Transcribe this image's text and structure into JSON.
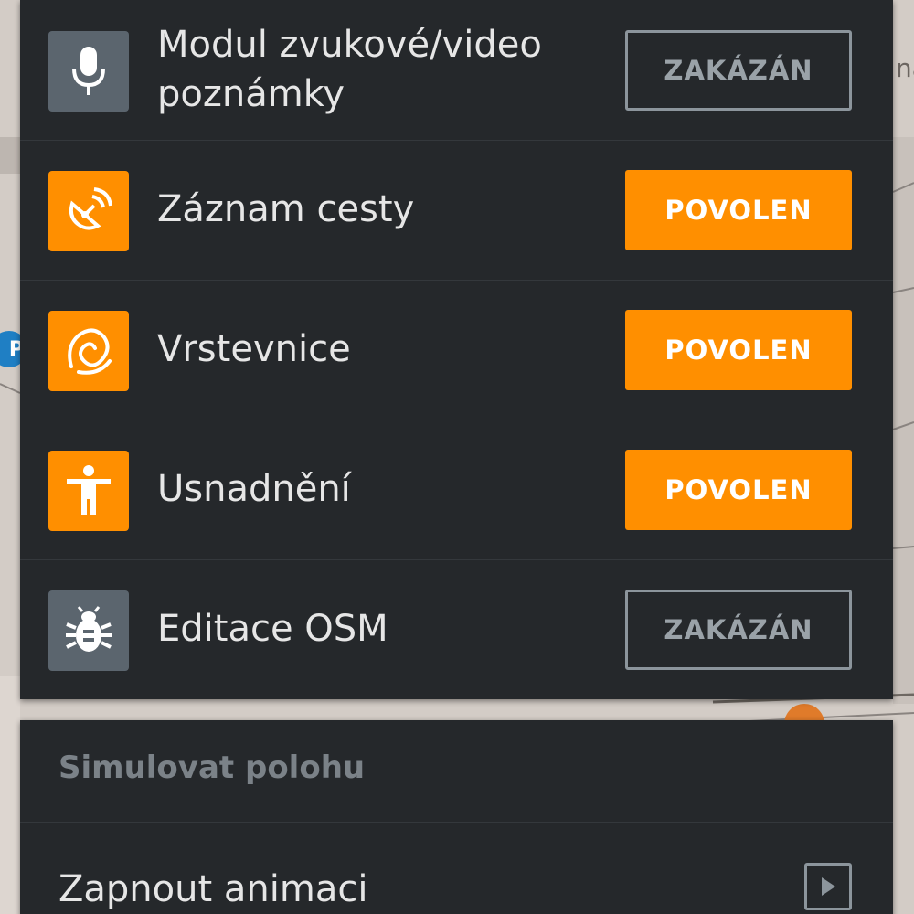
{
  "map": {
    "edge_text": "na"
  },
  "plugins": {
    "items": [
      {
        "label": "Modul zvukové/video poznámky",
        "state": "ZAKÁZÁN",
        "enabled": false,
        "icon": "microphone-icon"
      },
      {
        "label": "Záznam cesty",
        "state": "POVOLEN",
        "enabled": true,
        "icon": "satellite-dish-icon"
      },
      {
        "label": "Vrstevnice",
        "state": "POVOLEN",
        "enabled": true,
        "icon": "contour-lines-icon"
      },
      {
        "label": "Usnadnění",
        "state": "POVOLEN",
        "enabled": true,
        "icon": "accessibility-person-icon"
      },
      {
        "label": "Editace OSM",
        "state": "ZAKÁZÁN",
        "enabled": false,
        "icon": "bug-icon"
      }
    ]
  },
  "simulation": {
    "header": "Simulovat polohu",
    "item_label": "Zapnout animaci",
    "item_icon": "play-icon"
  },
  "colors": {
    "accent": "#ff8f00",
    "panel_bg": "#25282b",
    "disabled_border": "#8c959c"
  }
}
